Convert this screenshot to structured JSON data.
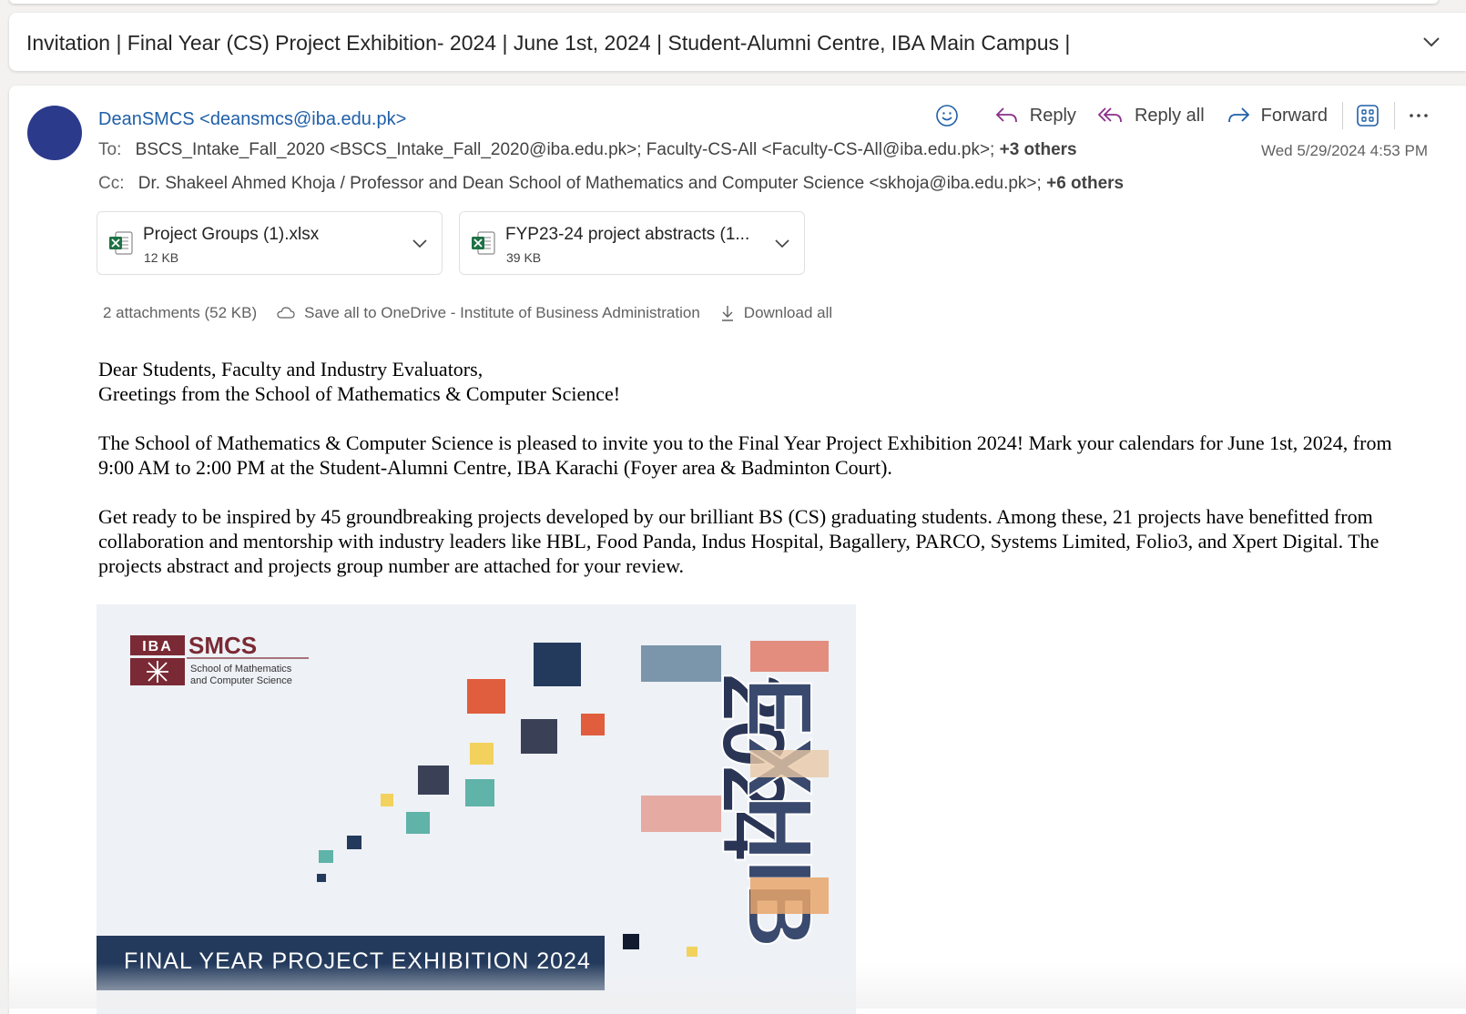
{
  "subject": "Invitation | Final Year (CS) Project Exhibition- 2024 | June 1st, 2024 | Student-Alumni Centre, IBA Main Campus |",
  "message": {
    "sender": "DeanSMCS <deansmcs@iba.edu.pk>",
    "to_label": "To:",
    "to_recipients": "BSCS_Intake_Fall_2020 <BSCS_Intake_Fall_2020@iba.edu.pk>;   Faculty-CS-All <Faculty-CS-All@iba.edu.pk>;",
    "to_more": "+3 others",
    "cc_label": "Cc:",
    "cc_recipients": "Dr. Shakeel Ahmed Khoja / Professor and Dean School of Mathematics and Computer Science <skhoja@iba.edu.pk>;",
    "cc_more": "+6 others",
    "date": "Wed 5/29/2024 4:53 PM"
  },
  "actions": {
    "reply": "Reply",
    "reply_all": "Reply all",
    "forward": "Forward"
  },
  "attachments": [
    {
      "name": "Project Groups (1).xlsx",
      "size": "12 KB"
    },
    {
      "name": "FYP23-24 project abstracts (1...",
      "size": "39 KB"
    }
  ],
  "attachment_bar": {
    "summary": "2 attachments (52 KB)",
    "save_all": "Save all to OneDrive - Institute of Business Administration",
    "download_all": "Download all"
  },
  "body": {
    "greeting_1": "Dear Students, Faculty and Industry Evaluators,",
    "greeting_2": "Greetings from the School of Mathematics & Computer Science!",
    "paragraph_1": "The School of Mathematics & Computer Science is pleased to invite you to the Final Year Project Exhibition 2024! Mark your calendars for June 1st, 2024, from 9:00 AM to 2:00 PM at the Student-Alumni Centre, IBA Karachi (Foyer area & Badminton Court).",
    "paragraph_2": "Get ready to be inspired by 45 groundbreaking projects developed by our brilliant BS (CS) graduating students. Among these, 21 projects have benefitted from collaboration and mentorship with industry leaders like HBL, Food Panda, Indus Hospital, Bagallery, PARCO, Systems Limited, Folio3, and Xpert Digital. The projects abstract and projects group number are attached for your review."
  },
  "poster": {
    "logo_iba": "IBA",
    "logo_smcs": "SMCS",
    "logo_subtitle_1": "School of Mathematics",
    "logo_subtitle_2": "and Computer Science",
    "year": "2024",
    "word": "EXHIB",
    "banner": "FINAL YEAR PROJECT EXHIBITION 2024"
  },
  "colors": {
    "accent": "#1f5fa8",
    "avatar": "#2c3a8c",
    "poster_navy": "#233a5c",
    "poster_orange": "#e05d3d",
    "poster_teal": "#5fb3a8",
    "poster_yellow": "#f2d25c",
    "logo_maroon": "#7a2a34"
  }
}
